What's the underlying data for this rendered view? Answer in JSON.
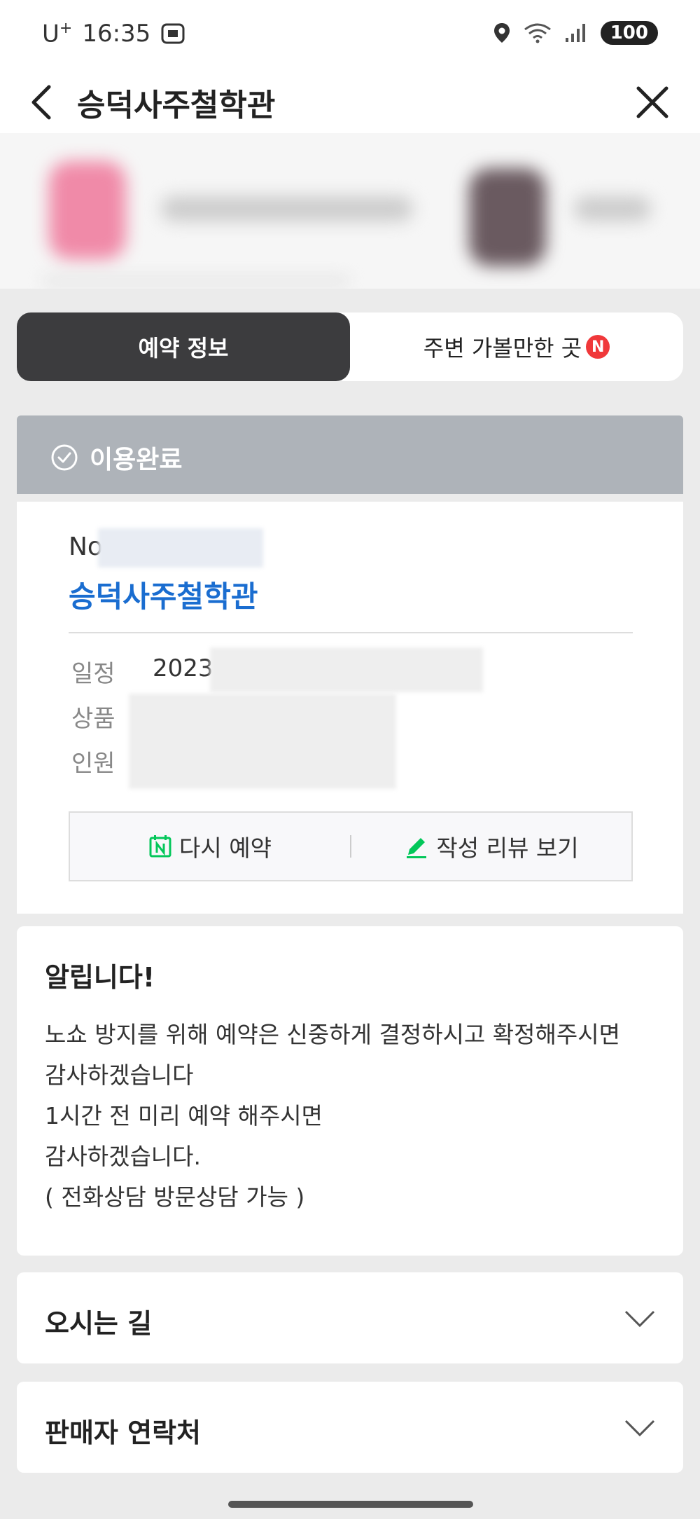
{
  "status_bar": {
    "carrier": "U",
    "carrier_sup": "+",
    "time": "16:35",
    "battery": "100"
  },
  "header": {
    "title": "승덕사주철학관"
  },
  "tabs": [
    {
      "label": "예약 정보",
      "active": true
    },
    {
      "label": "주변 가볼만한 곳",
      "badge": "N",
      "active": false
    }
  ],
  "reservation": {
    "status": "이용완료",
    "number_prefix": "No",
    "shop_name": "승덕사주철학관",
    "rows": [
      {
        "label": "일정",
        "value": "2023"
      },
      {
        "label": "상품",
        "value": ""
      },
      {
        "label": "인원",
        "value": ""
      }
    ],
    "actions": {
      "rebook": "다시 예약",
      "review": "작성 리뷰 보기"
    }
  },
  "notice": {
    "title": "알립니다!",
    "lines": [
      "노쇼 방지를 위해 예약은 신중하게 결정하시고 확정해주시면",
      "감사하겠습니다",
      "1시간 전 미리 예약 해주시면",
      "감사하겠습니다.",
      "( 전화상담 방문상담 가능 )"
    ]
  },
  "sections": {
    "directions": "오시는 길",
    "seller_contact": "판매자 연락처"
  },
  "colors": {
    "brand_blue": "#1a6dd0",
    "naver_green": "#03c75a",
    "status_gray": "#aeb3b9",
    "tab_dark": "#3c3c3e",
    "badge_red": "#f0383a"
  }
}
